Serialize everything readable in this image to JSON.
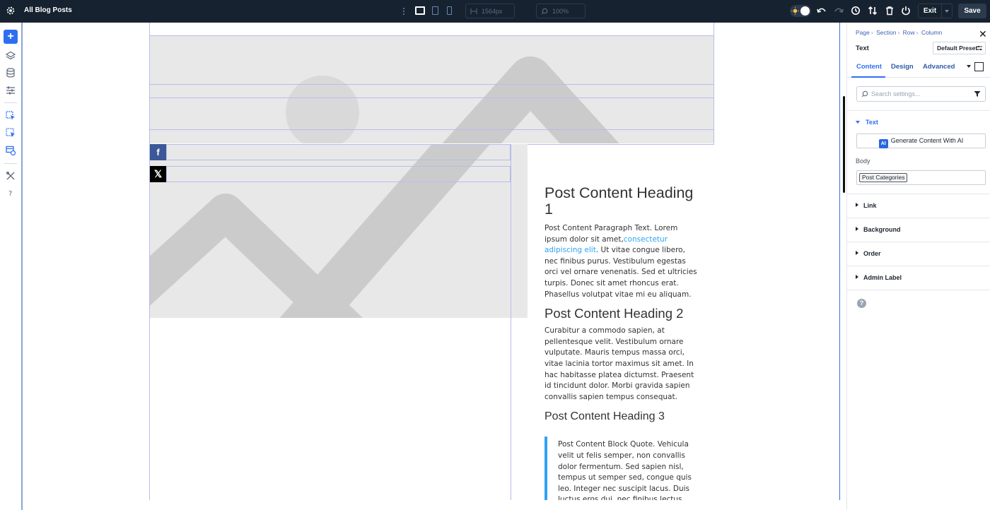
{
  "topbar": {
    "title": "All Blog Posts",
    "width_value": "1564px",
    "zoom_value": "100%",
    "exit_label": "Exit",
    "save_label": "Save"
  },
  "article": {
    "heading1": "Post Content Heading 1",
    "para1_start": "Post Content Paragraph Text. Lorem ipsum dolor sit amet,",
    "para1_link": "consectetur adipiscing elit",
    "para1_end": ". Ut vitae congue libero, nec finibus purus. Vestibulum egestas orci vel ornare venenatis. Sed et ultricies turpis. Donec sit amet rhoncus erat. Phasellus volutpat vitae mi eu aliquam.",
    "heading2": "Post Content Heading 2",
    "para2": "Curabitur a commodo sapien, at pellentesque velit. Vestibulum ornare vulputate. Mauris tempus massa orci, vitae lacinia tortor maximus sit amet. In hac habitasse platea dictumst. Praesent id tincidunt dolor. Morbi gravida sapien convallis sapien tempus consequat.",
    "heading3": "Post Content Heading 3",
    "quote": "Post Content Block Quote. Vehicula velit ut felis semper, non convallis dolor fermentum. Sed sapien nisl, tempus ut semper sed, congue quis leo. Integer nec suscipit lacus. Duis luctus eros dui, nec finibus lectus tempor nec."
  },
  "social": {
    "facebook": "f",
    "x": "𝕏"
  },
  "panel": {
    "breadcrumb": [
      "Page",
      "Section",
      "Row",
      "Column"
    ],
    "element_title": "Text",
    "preset_label": "Default Preset",
    "tabs": [
      "Content",
      "Design",
      "Advanced"
    ],
    "search_placeholder": "Search settings...",
    "groups": {
      "text": "Text",
      "generate_label": "Generate Content With AI",
      "ai_badge": "AI",
      "body_label": "Body",
      "body_tag": "Post Categories",
      "link": "Link",
      "background": "Background",
      "order": "Order",
      "admin_label": "Admin Label"
    }
  },
  "colors": {
    "topbar_bg": "#172230",
    "accent": "#2e6ff2",
    "link": "#2ea3f2",
    "placeholder_bg": "#e8e8e9",
    "facebook": "#3b5998"
  }
}
